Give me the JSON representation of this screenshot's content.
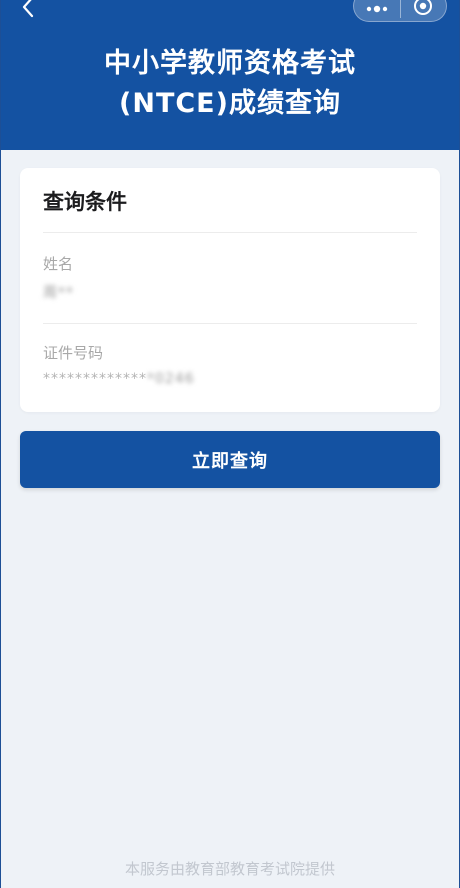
{
  "header": {
    "title_line1": "中小学教师资格考试",
    "title_line2": "(NTCE)成绩查询",
    "background": "#1452a2"
  },
  "nav": {
    "back_icon": "chevron-left-icon",
    "more_icon": "more-dots-icon",
    "close_icon": "target-circle-icon"
  },
  "form": {
    "section_title": "查询条件",
    "name_label": "姓名",
    "name_value": "周**",
    "id_label": "证件号码",
    "id_value_masked": "*************",
    "id_value_tail": "*0246"
  },
  "submit_label": "立即查询",
  "footer_text": "本服务由教育部教育考试院提供"
}
